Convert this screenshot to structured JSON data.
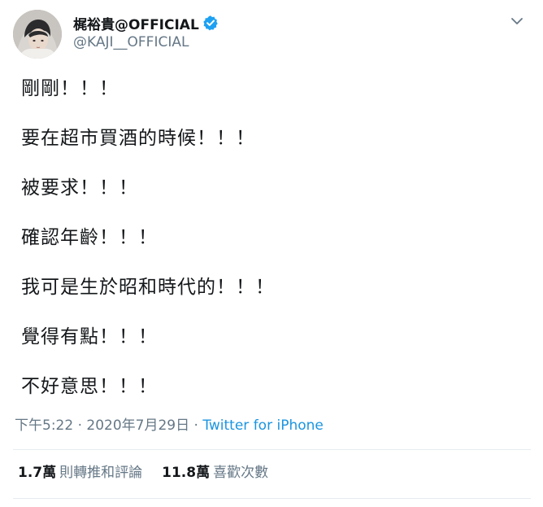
{
  "user": {
    "display_name": "梶裕貴@OFFICIAL",
    "handle": "@KAJI__OFFICIAL",
    "verified": true,
    "avatar_icon": "user-avatar-icon"
  },
  "menu": {
    "caret_icon": "chevron-down-icon"
  },
  "tweet": {
    "lines": [
      "剛剛！！！",
      "要在超市買酒的時候！！！",
      "被要求！！！",
      "確認年齡！！！",
      "我可是生於昭和時代的！！！",
      "覺得有點！！！",
      "不好意思！！！"
    ],
    "time": "下午5:22 · 2020年7月29日 · ",
    "source": "Twitter for iPhone"
  },
  "stats": {
    "retweets_count": "1.7萬",
    "retweets_label": "則轉推和評論",
    "likes_count": "11.8萬",
    "likes_label": "喜歡次數"
  },
  "colors": {
    "text_primary": "#14171a",
    "text_secondary": "#657786",
    "link": "#1b95e0",
    "verified": "#1da1f2",
    "divider": "#e6ecf0"
  }
}
